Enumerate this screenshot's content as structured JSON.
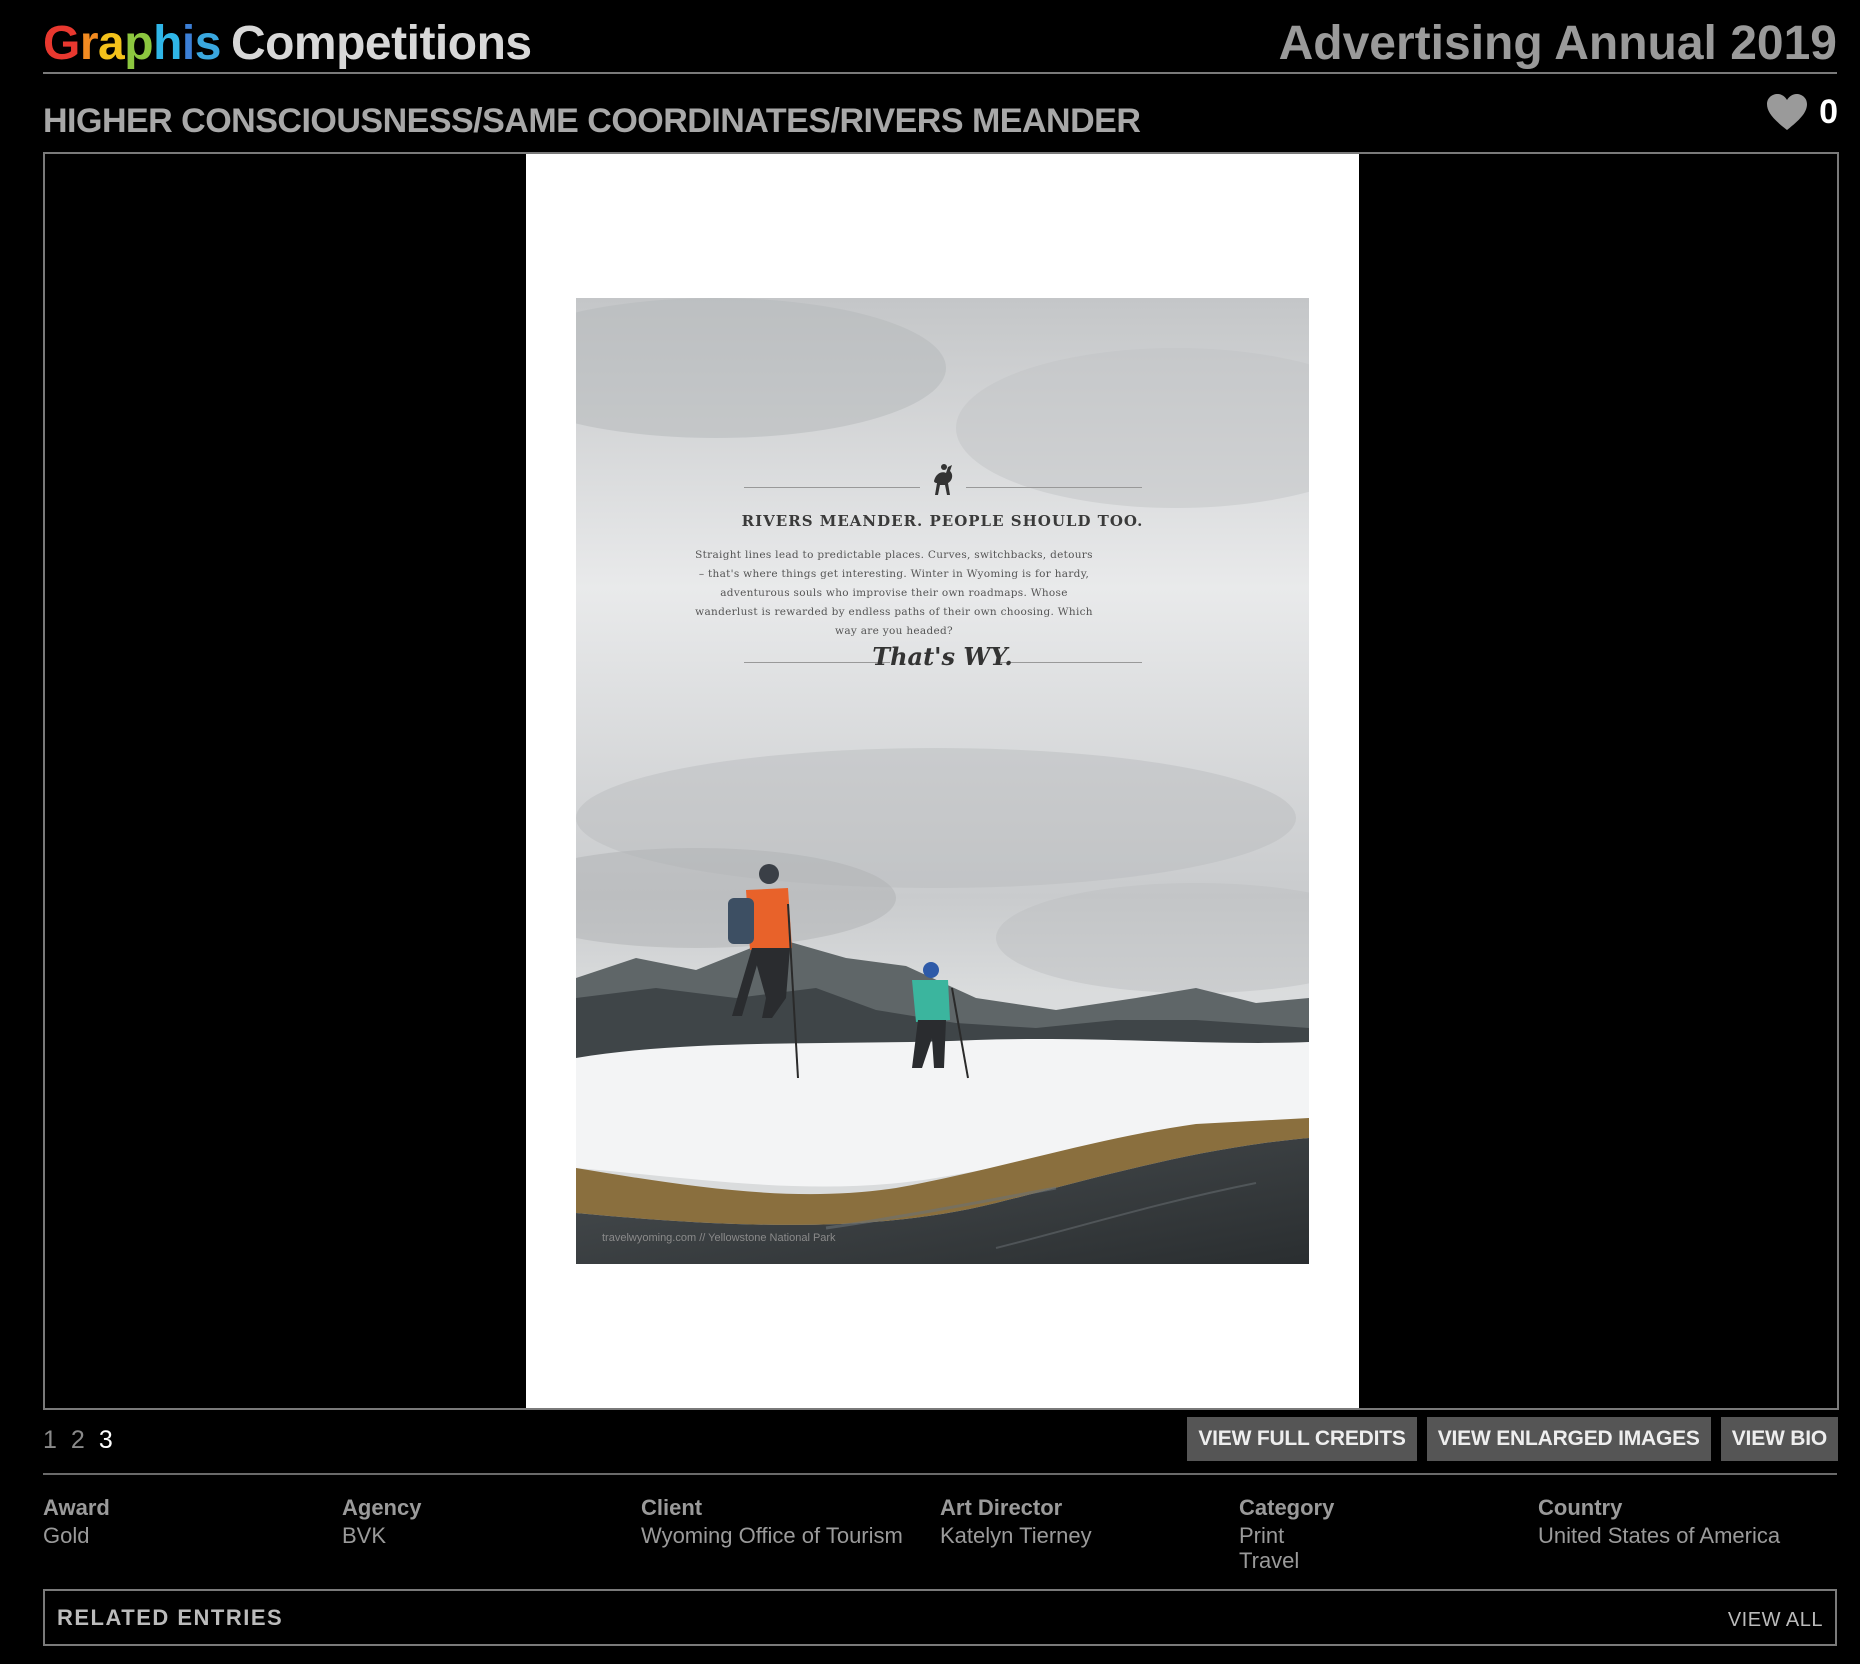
{
  "header": {
    "logo_letters": [
      "G",
      "r",
      "a",
      "p",
      "h",
      "i",
      "s"
    ],
    "logo_suffix": "Competitions",
    "annual": "Advertising Annual 2019"
  },
  "entry": {
    "title": "HIGHER CONSCIOUSNESS/SAME COORDINATES/RIVERS MEANDER",
    "likes": "0",
    "like_icon": "heart-icon"
  },
  "ad": {
    "headline": "RIVERS MEANDER. PEOPLE SHOULD TOO.",
    "copy": "Straight lines lead to predictable places. Curves, switchbacks, detours – that's where things get interesting. Winter in Wyoming is for hardy, adventurous souls who improvise their own roadmaps. Whose wanderlust is rewarded by endless paths of their own choosing. Which way are you headed?",
    "tagline": "That's WY.",
    "credit": "travelwyoming.com // Yellowstone National Park"
  },
  "pager": {
    "pages": [
      "1",
      "2",
      "3"
    ],
    "current": "3"
  },
  "actions": {
    "full_credits": "VIEW FULL CREDITS",
    "enlarged": "VIEW ENLARGED IMAGES",
    "bio": "VIEW BIO"
  },
  "meta": {
    "award": {
      "label": "Award",
      "value": "Gold"
    },
    "agency": {
      "label": "Agency",
      "value": "BVK"
    },
    "client": {
      "label": "Client",
      "value": "Wyoming Office of Tourism"
    },
    "art_director": {
      "label": "Art Director",
      "value": "Katelyn Tierney"
    },
    "category": {
      "label": "Category",
      "values": [
        "Print",
        "Travel"
      ]
    },
    "country": {
      "label": "Country",
      "value": "United States of America"
    }
  },
  "related": {
    "title": "RELATED ENTRIES",
    "view_all": "VIEW ALL"
  }
}
